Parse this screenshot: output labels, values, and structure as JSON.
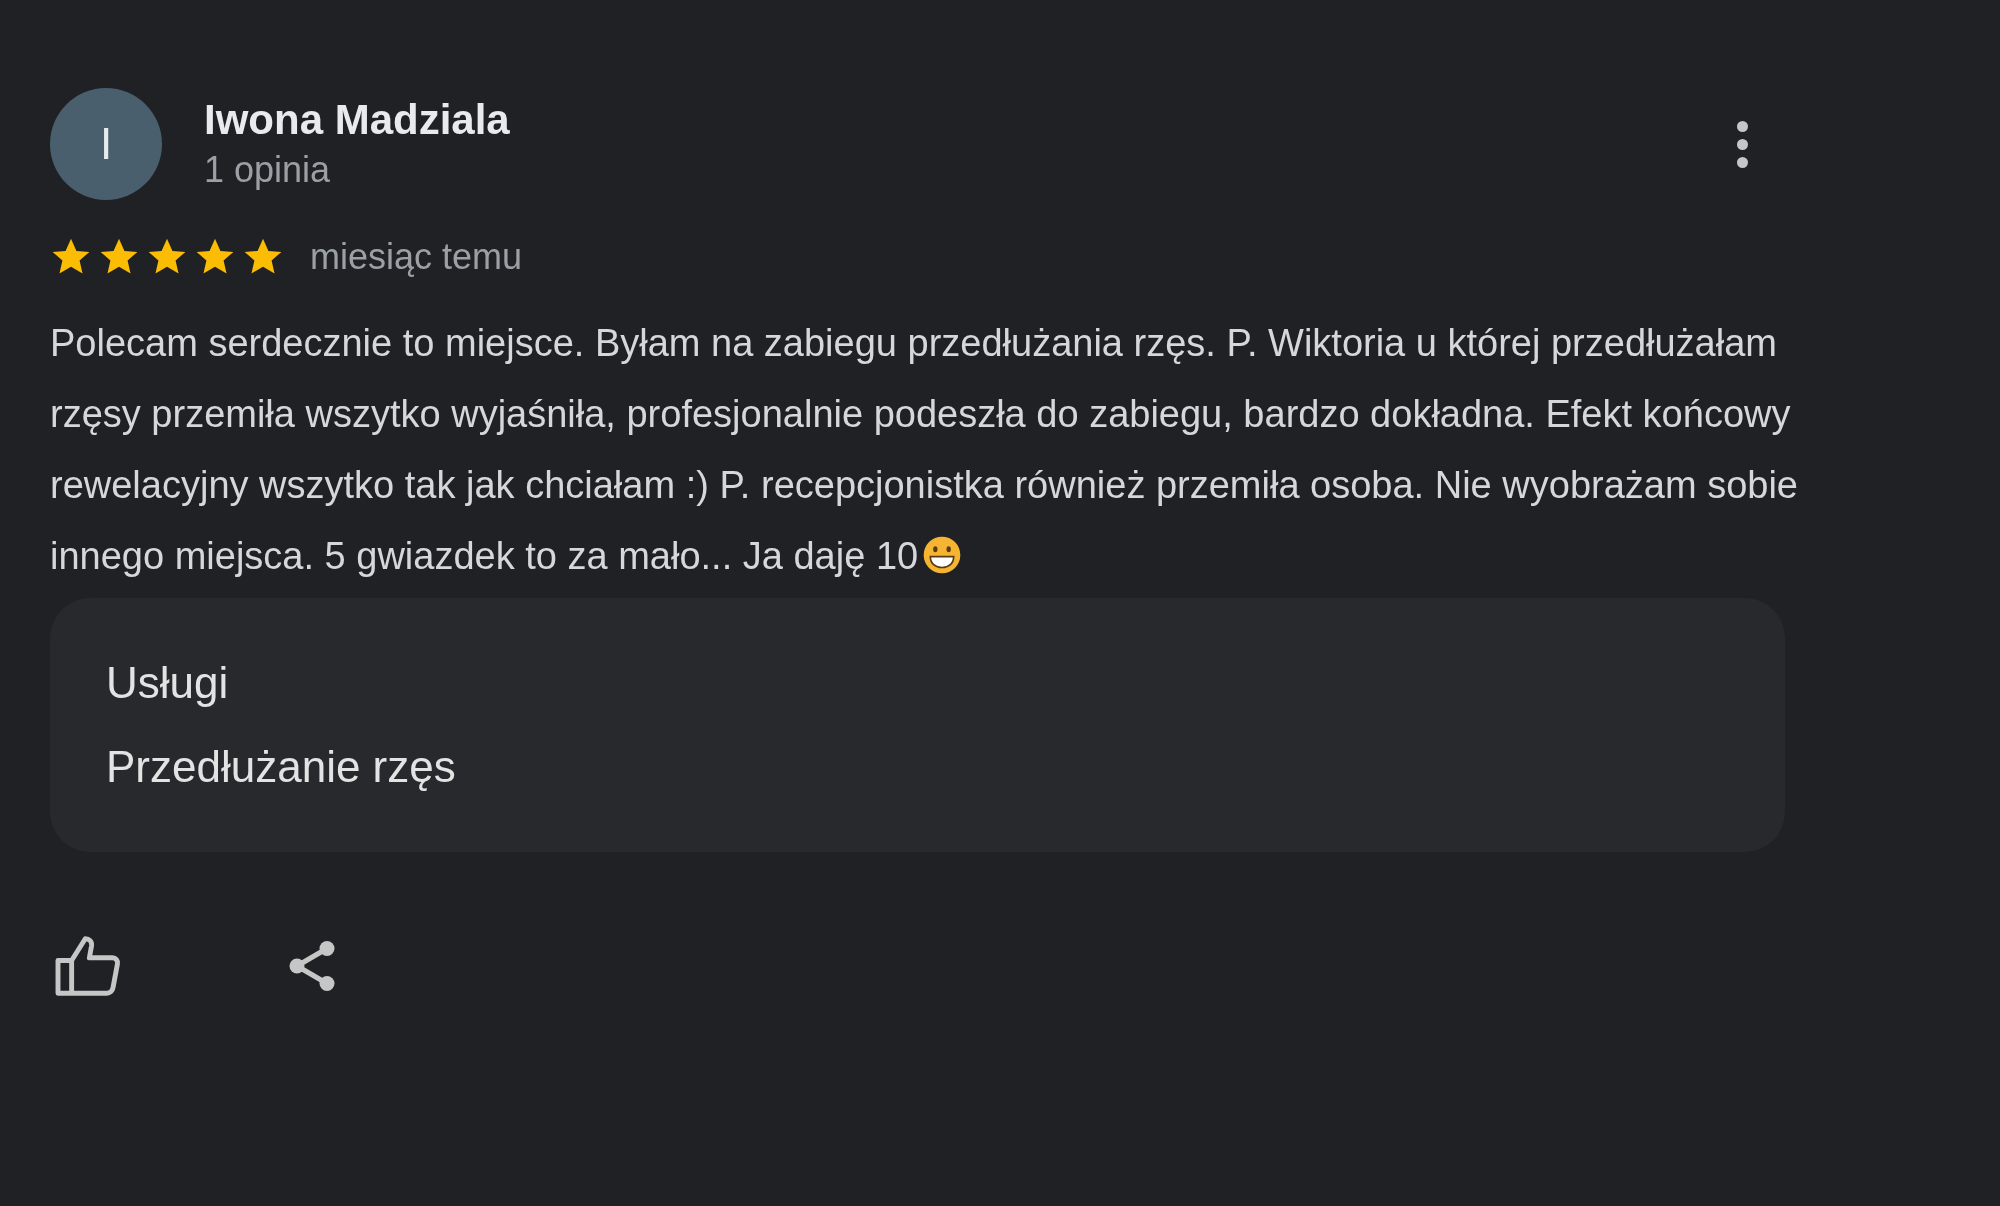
{
  "review": {
    "avatar_letter": "I",
    "author": "Iwona Madziala",
    "author_meta": "1 opinia",
    "stars": 5,
    "time": "miesiąc temu",
    "text": "Polecam serdecznie to miejsce. Byłam na zabiegu przedłużania rzęs. P. Wiktoria u której przedłużałam rzęsy przemiła wszytko wyjaśniła, profesjonalnie podeszła do zabiegu, bardzo dokładna. Efekt końcowy rewelacyjny wszytko tak jak chciałam :) P. recepcjonistka również przemiła osoba. Nie wyobrażam sobie innego miejsca. 5 gwiazdek to za mało... Ja daję 10",
    "details": [
      {
        "label": "Usługi"
      },
      {
        "label": "Przedłużanie rzęs"
      }
    ]
  }
}
